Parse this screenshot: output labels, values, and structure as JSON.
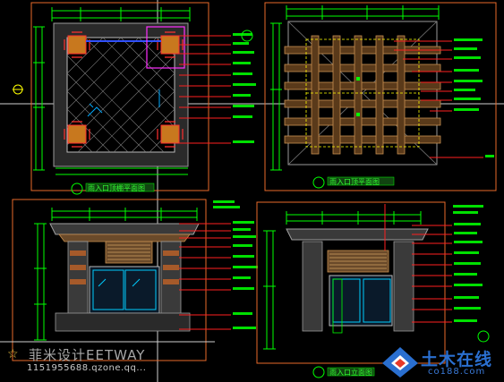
{
  "drawing": {
    "views": [
      {
        "id": "1",
        "title": "雨入口顶棚平面图"
      },
      {
        "id": "2",
        "title": "雨入口顶平面图"
      },
      {
        "id": "3",
        "title": "雨入口立面图"
      },
      {
        "id": "4",
        "title": "雨入口立面图"
      }
    ],
    "colors": {
      "background": "#000000",
      "frame": "#e86a2a",
      "dimension": "#00ff00",
      "leader": "#ff2020",
      "annotation": "#00e000",
      "hatch": "#8a8a8a",
      "highlight": "#ff30ff",
      "yellow": "#ffff00"
    }
  },
  "watermark": {
    "site_name": "菲米设计EETWAY",
    "contact": "1151955688.qzone.qq..."
  },
  "logo": {
    "chinese": "土木在线",
    "english": "co188.com"
  }
}
